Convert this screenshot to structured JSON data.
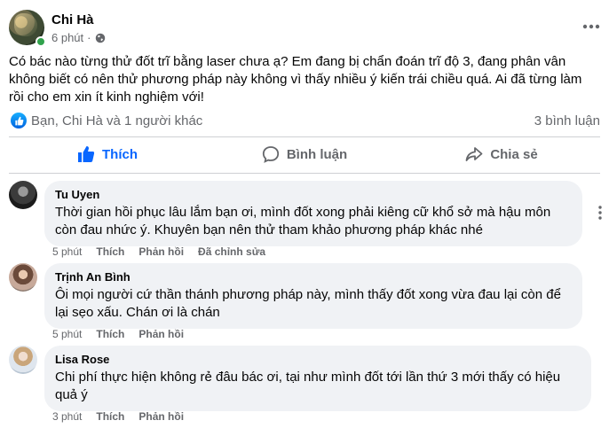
{
  "post": {
    "author": "Chi Hà",
    "time": "6 phút",
    "privacy_icon": "globe-icon",
    "text": "Có bác nào từng thử đốt trĩ bằng laser chưa ạ? Em đang bị chẩn đoán trĩ độ 3, đang phân vân không biết có nên thử phương pháp này không vì thấy nhiều ý kiến trái chiều quá. Ai đã từng làm rồi cho em xin ít kinh nghiệm với!"
  },
  "reactions": {
    "summary": "Bạn, Chi Hà và 1 người khác",
    "comments_count": "3 bình luận"
  },
  "actions": {
    "like": "Thích",
    "comment": "Bình luận",
    "share": "Chia sẻ"
  },
  "comments": [
    {
      "name": "Tu Uyen",
      "text": "Thời gian hồi phục lâu lắm bạn ơi, mình đốt xong phải kiêng cữ khổ sở mà hậu môn còn đau nhức ý. Khuyên bạn nên thử tham khảo phương pháp khác nhé",
      "time": "5 phút",
      "like": "Thích",
      "reply": "Phản hồi",
      "edited": "Đã chỉnh sửa"
    },
    {
      "name": "Trịnh An Bình",
      "text": "Ôi mọi người cứ thần thánh phương pháp này, mình thấy đốt xong vừa đau lại còn để lại sẹo xấu. Chán ơi là chán",
      "time": "5 phút",
      "like": "Thích",
      "reply": "Phản hồi"
    },
    {
      "name": "Lisa Rose",
      "text": "Chi phí thực hiện không rẻ đâu bác ơi, tại như mình đốt tới lần thứ 3 mới thấy có hiệu quả ý",
      "time": "3 phút",
      "like": "Thích",
      "reply": "Phản hồi"
    }
  ],
  "colors": {
    "accent": "#0866ff",
    "secondary_text": "#65676b",
    "bubble": "#f0f2f5",
    "online": "#31a24c"
  }
}
